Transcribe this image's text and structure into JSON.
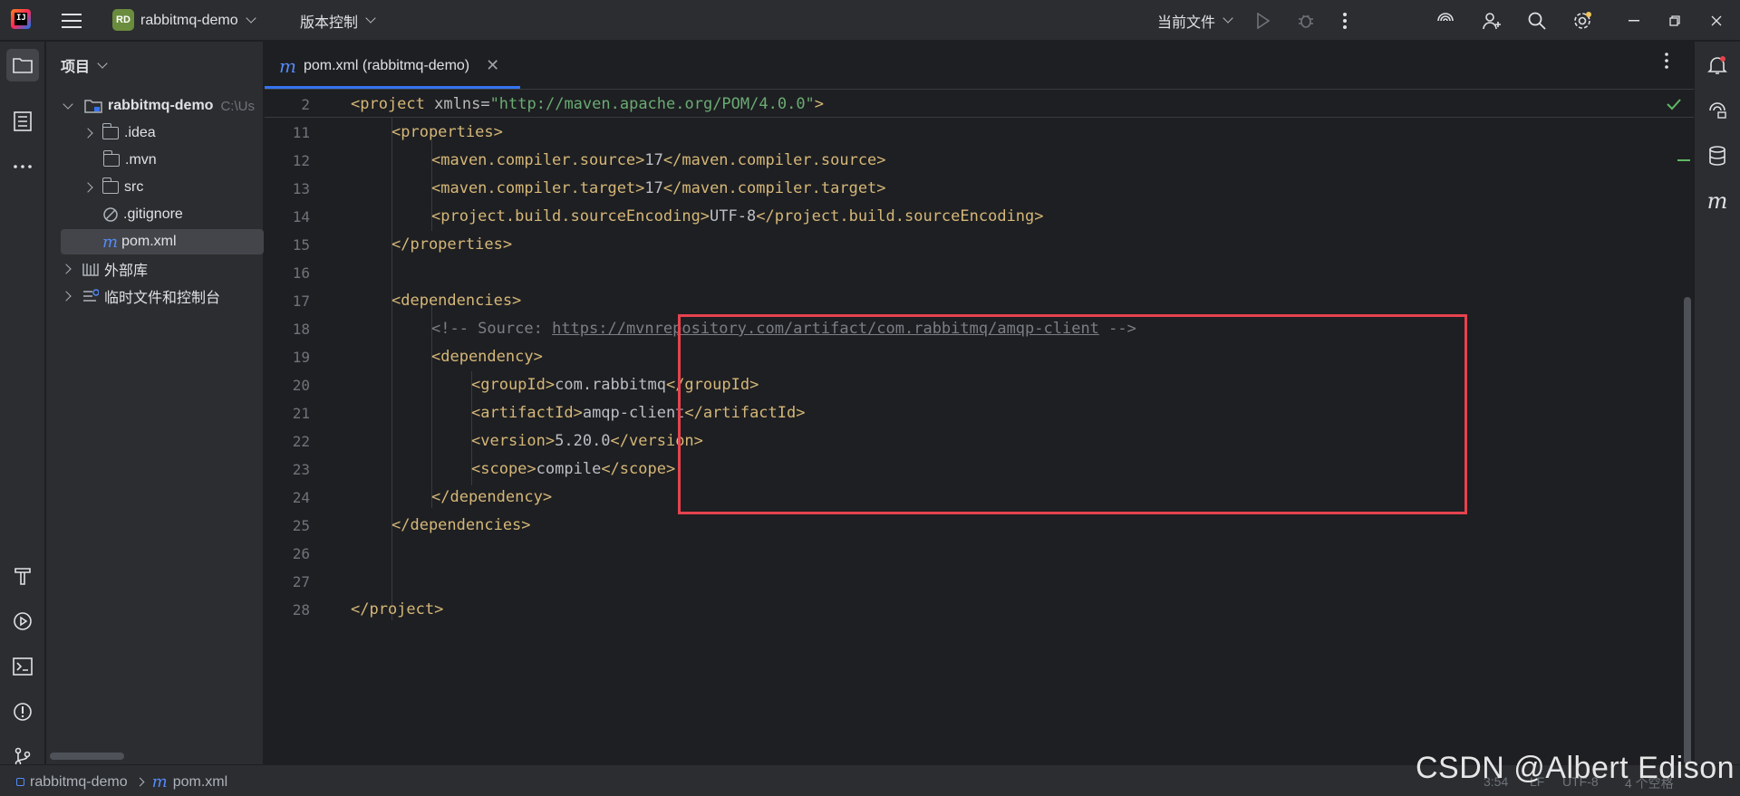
{
  "titlebar": {
    "project_badge": "RD",
    "project_name": "rabbitmq-demo",
    "vcs_label": "版本控制",
    "run_config": "当前文件"
  },
  "project_panel": {
    "header": "项目",
    "root": {
      "name": "rabbitmq-demo",
      "path": "C:\\Us"
    },
    "items": [
      {
        "label": ".idea"
      },
      {
        "label": ".mvn"
      },
      {
        "label": "src"
      },
      {
        "label": ".gitignore"
      },
      {
        "label": "pom.xml"
      }
    ],
    "external_libs": "外部库",
    "scratches": "临时文件和控制台"
  },
  "tab": {
    "label": "pom.xml (rabbitmq-demo)"
  },
  "editor": {
    "sticky": {
      "line": "2",
      "tag_open": "<project ",
      "attr": "xmlns",
      "eq": "=",
      "value": "\"http://maven.apache.org/POM/4.0.0\"",
      "tag_close": ">"
    },
    "line_numbers": [
      "11",
      "12",
      "13",
      "14",
      "15",
      "16",
      "17",
      "18",
      "19",
      "20",
      "21",
      "22",
      "23",
      "24",
      "25",
      "26",
      "27",
      "28"
    ],
    "lines": {
      "l11_tag": "<properties>",
      "l12_open": "<maven.compiler.source>",
      "l12_val": "17",
      "l12_close": "</maven.compiler.source>",
      "l13_open": "<maven.compiler.target>",
      "l13_val": "17",
      "l13_close": "</maven.compiler.target>",
      "l14_open": "<project.build.sourceEncoding>",
      "l14_val": "UTF-8",
      "l14_close": "</project.build.sourceEncoding>",
      "l15_tag": "</properties>",
      "l17_tag": "<dependencies>",
      "l18_pre": "<!-- Source: ",
      "l18_link": "https://mvnrepository.com/artifact/com.rabbitmq/amqp-client",
      "l18_post": " -->",
      "l19_tag": "<dependency>",
      "l20_open": "<groupId>",
      "l20_val": "com.rabbitmq",
      "l20_close": "</groupId>",
      "l21_open": "<artifactId>",
      "l21_val": "amqp-client",
      "l21_close": "</artifactId>",
      "l22_open": "<version>",
      "l22_val": "5.20.0",
      "l22_close": "</version>",
      "l23_open": "<scope>",
      "l23_val": "compile",
      "l23_close": "</scope>",
      "l24_tag": "</dependency>",
      "l25_tag": "</dependencies>",
      "l28_tag": "</project>"
    }
  },
  "statusbar": {
    "crumb_project": "rabbitmq-demo",
    "crumb_file": "pom.xml",
    "position": "3:54",
    "line_sep": "LF",
    "encoding": "UTF-8",
    "indent": "4 个空格"
  },
  "watermark": "CSDN @Albert Edison",
  "colors": {
    "accent": "#3574f0",
    "highlight": "#e5434f",
    "tag": "#d5b778",
    "string": "#6aab73",
    "comment": "#7a7e85"
  }
}
